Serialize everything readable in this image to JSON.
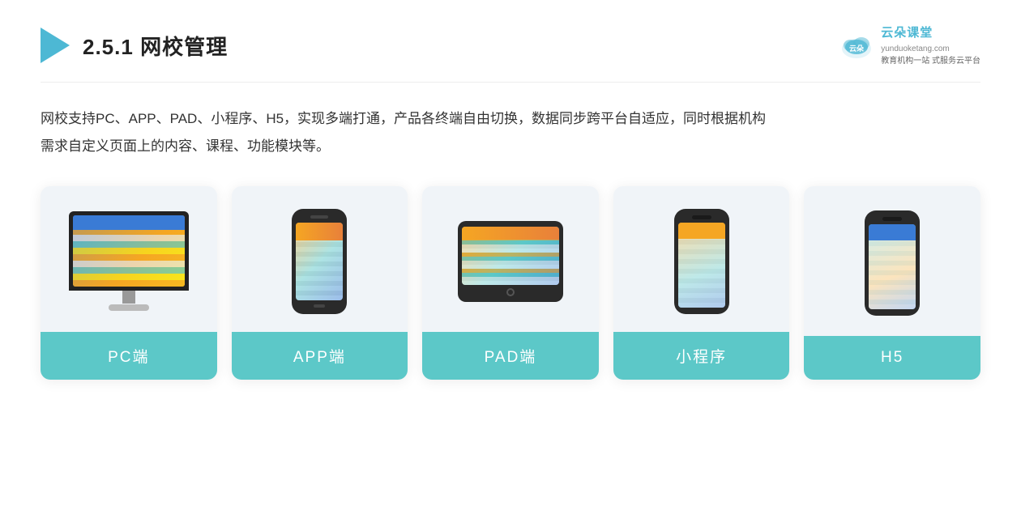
{
  "header": {
    "title_prefix": "2.5.1 ",
    "title_bold": "网校管理",
    "brand": {
      "name": "云朵课堂",
      "url": "yunduoketang.com",
      "tagline1": "教育机构一站",
      "tagline2": "式服务云平台"
    }
  },
  "description": {
    "line1": "网校支持PC、APP、PAD、小程序、H5，实现多端打通，产品各终端自由切换，数据同步跨平台自适应，同时根据机构",
    "line2": "需求自定义页面上的内容、课程、功能模块等。"
  },
  "cards": [
    {
      "id": "pc",
      "label": "PC端"
    },
    {
      "id": "app",
      "label": "APP端"
    },
    {
      "id": "pad",
      "label": "PAD端"
    },
    {
      "id": "miniprogram",
      "label": "小程序"
    },
    {
      "id": "h5",
      "label": "H5"
    }
  ]
}
